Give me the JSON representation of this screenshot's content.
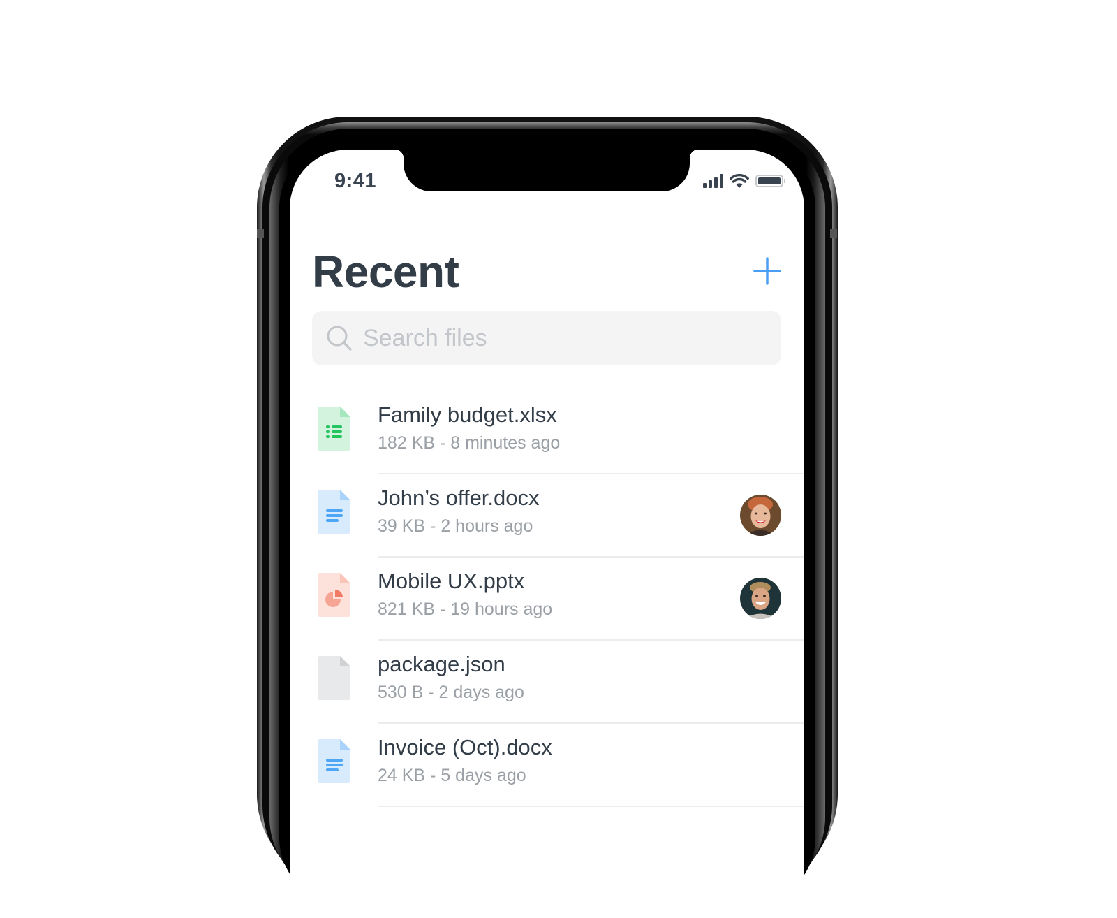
{
  "status_bar": {
    "time": "9:41",
    "signal_icon": "signal-icon",
    "wifi_icon": "wifi-icon",
    "battery_icon": "battery-icon"
  },
  "header": {
    "title": "Recent",
    "add_icon": "plus-icon"
  },
  "search": {
    "placeholder": "Search files",
    "value": "",
    "icon": "search-icon"
  },
  "colors": {
    "accent": "#4a9ff5",
    "text": "#323d48",
    "muted": "#9aa0a6",
    "sheet": "#22c55e",
    "doc": "#4ea6f5",
    "slides": "#f07a62"
  },
  "files": [
    {
      "name": "Family budget.xlsx",
      "meta": "182 KB - 8 minutes ago",
      "type": "spreadsheet",
      "icon": "spreadsheet-file-icon",
      "shared_with": null
    },
    {
      "name": "John’s offer.docx",
      "meta": "39 KB - 2 hours ago",
      "type": "document",
      "icon": "document-file-icon",
      "shared_with": "avatar-woman"
    },
    {
      "name": "Mobile UX.pptx",
      "meta": "821 KB - 19 hours ago",
      "type": "presentation",
      "icon": "presentation-file-icon",
      "shared_with": "avatar-man"
    },
    {
      "name": "package.json",
      "meta": "530 B - 2 days ago",
      "type": "generic",
      "icon": "generic-file-icon",
      "shared_with": null
    },
    {
      "name": "Invoice (Oct).docx",
      "meta": "24 KB - 5 days ago",
      "type": "document",
      "icon": "document-file-icon",
      "shared_with": null
    }
  ]
}
